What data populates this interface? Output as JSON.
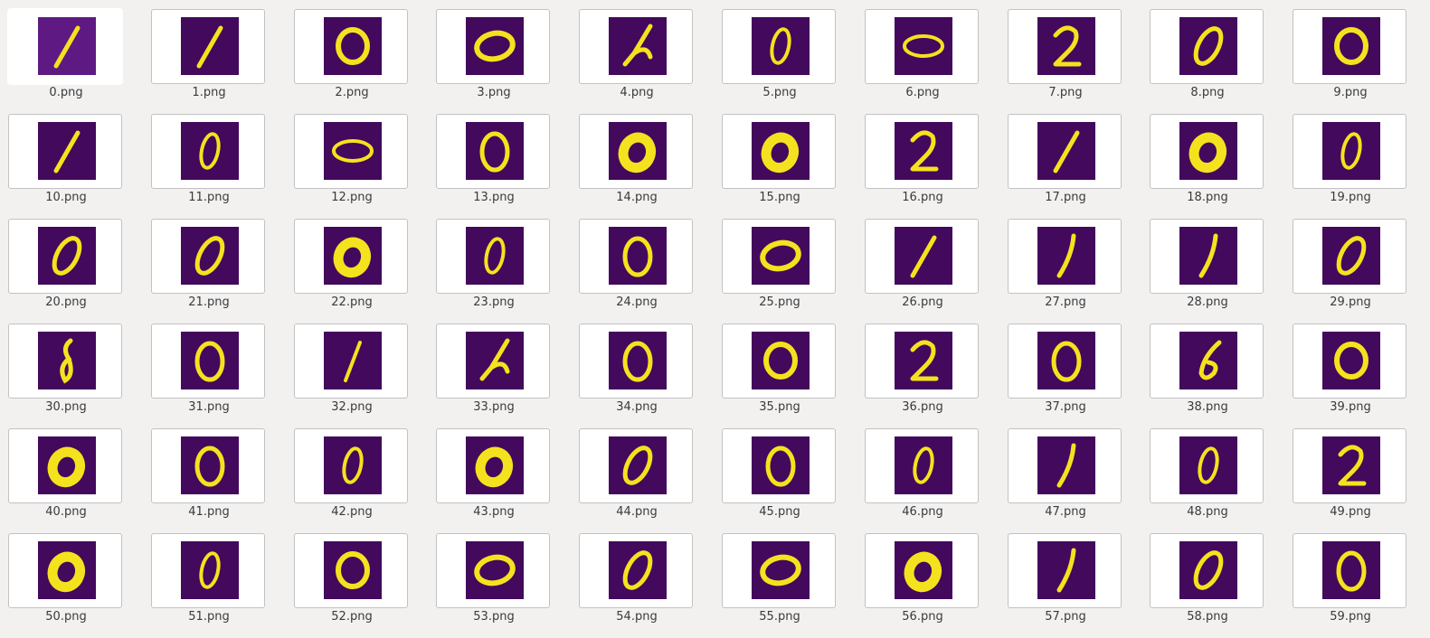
{
  "gallery": {
    "selected_index": 0,
    "colors": {
      "background": "#43095c",
      "stroke": "#f5e21e",
      "edge": "#3ab59a"
    },
    "items": [
      {
        "name": "0.png",
        "glyph": "1a"
      },
      {
        "name": "1.png",
        "glyph": "1a"
      },
      {
        "name": "2.png",
        "glyph": "0r"
      },
      {
        "name": "3.png",
        "glyph": "0w"
      },
      {
        "name": "4.png",
        "glyph": "4c"
      },
      {
        "name": "5.png",
        "glyph": "0n"
      },
      {
        "name": "6.png",
        "glyph": "0f"
      },
      {
        "name": "7.png",
        "glyph": "2"
      },
      {
        "name": "8.png",
        "glyph": "0s"
      },
      {
        "name": "9.png",
        "glyph": "0r"
      },
      {
        "name": "10.png",
        "glyph": "1a"
      },
      {
        "name": "11.png",
        "glyph": "0n"
      },
      {
        "name": "12.png",
        "glyph": "0f"
      },
      {
        "name": "13.png",
        "glyph": "0"
      },
      {
        "name": "14.png",
        "glyph": "0b"
      },
      {
        "name": "15.png",
        "glyph": "0b"
      },
      {
        "name": "16.png",
        "glyph": "2"
      },
      {
        "name": "17.png",
        "glyph": "1a"
      },
      {
        "name": "18.png",
        "glyph": "0b"
      },
      {
        "name": "19.png",
        "glyph": "0n"
      },
      {
        "name": "20.png",
        "glyph": "0s"
      },
      {
        "name": "21.png",
        "glyph": "0s"
      },
      {
        "name": "22.png",
        "glyph": "0b"
      },
      {
        "name": "23.png",
        "glyph": "0n"
      },
      {
        "name": "24.png",
        "glyph": "0"
      },
      {
        "name": "25.png",
        "glyph": "0w"
      },
      {
        "name": "26.png",
        "glyph": "1a"
      },
      {
        "name": "27.png",
        "glyph": "1c"
      },
      {
        "name": "28.png",
        "glyph": "1c"
      },
      {
        "name": "29.png",
        "glyph": "0s"
      },
      {
        "name": "30.png",
        "glyph": "8"
      },
      {
        "name": "31.png",
        "glyph": "0"
      },
      {
        "name": "32.png",
        "glyph": "1b"
      },
      {
        "name": "33.png",
        "glyph": "4c"
      },
      {
        "name": "34.png",
        "glyph": "0"
      },
      {
        "name": "35.png",
        "glyph": "0r"
      },
      {
        "name": "36.png",
        "glyph": "2"
      },
      {
        "name": "37.png",
        "glyph": "0"
      },
      {
        "name": "38.png",
        "glyph": "6"
      },
      {
        "name": "39.png",
        "glyph": "0r"
      },
      {
        "name": "40.png",
        "glyph": "0b"
      },
      {
        "name": "41.png",
        "glyph": "0"
      },
      {
        "name": "42.png",
        "glyph": "0n"
      },
      {
        "name": "43.png",
        "glyph": "0b"
      },
      {
        "name": "44.png",
        "glyph": "0s"
      },
      {
        "name": "45.png",
        "glyph": "0"
      },
      {
        "name": "46.png",
        "glyph": "0n"
      },
      {
        "name": "47.png",
        "glyph": "1c"
      },
      {
        "name": "48.png",
        "glyph": "0n"
      },
      {
        "name": "49.png",
        "glyph": "2"
      },
      {
        "name": "50.png",
        "glyph": "0b"
      },
      {
        "name": "51.png",
        "glyph": "0n"
      },
      {
        "name": "52.png",
        "glyph": "0r"
      },
      {
        "name": "53.png",
        "glyph": "0w"
      },
      {
        "name": "54.png",
        "glyph": "0s"
      },
      {
        "name": "55.png",
        "glyph": "0w"
      },
      {
        "name": "56.png",
        "glyph": "0b"
      },
      {
        "name": "57.png",
        "glyph": "1c"
      },
      {
        "name": "58.png",
        "glyph": "0s"
      },
      {
        "name": "59.png",
        "glyph": "0"
      }
    ]
  }
}
